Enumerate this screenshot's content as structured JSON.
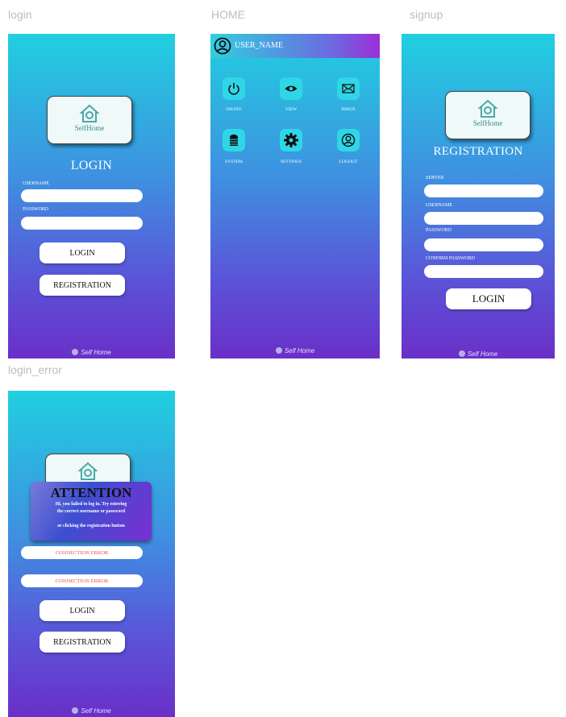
{
  "frames": {
    "login": "login",
    "home": "HOME",
    "signup": "signup",
    "login_error": "login_error"
  },
  "logo_text": "SelfHome",
  "footer_text": "Self Home",
  "login": {
    "title": "LOGIN",
    "username_label": "USERNAME",
    "password_label": "PASSWORD",
    "login_button": "LOGIN",
    "registration_button": "REGISTRATION"
  },
  "home": {
    "user_name": "USER_NAME",
    "tiles": [
      {
        "label": "ON/OFF",
        "icon": "power-icon"
      },
      {
        "label": "VIEW",
        "icon": "eye-icon"
      },
      {
        "label": "INBOX",
        "icon": "envelope-icon"
      },
      {
        "label": "SYSTEM",
        "icon": "stack-icon"
      },
      {
        "label": "SETTINGS",
        "icon": "gear-icon"
      },
      {
        "label": "LOGOUT",
        "icon": "user-circle-icon"
      }
    ]
  },
  "signup": {
    "title": "REGISTRATION",
    "server_label": "SERVER",
    "username_label": "USERNAME",
    "password_label": "PASSWORD",
    "confirm_label": "CONFIRM PASSWORD",
    "login_button": "LOGIN"
  },
  "login_error": {
    "attention_title": "ATTENTION",
    "message_line1": "Hi, you failed to log in. Try entering",
    "message_line2": "the correct username or password",
    "message_line3": "or clicking the registration button",
    "error1": "CONNECTION ERROR",
    "error2": "CONNECTION ERROR",
    "login_button": "LOGIN",
    "registration_button": "REGISTRATION"
  },
  "colors": {
    "gradient_top": "#21cfe0",
    "gradient_bottom": "#6a2fc8",
    "tile": "#2fd7e6",
    "error_text": "#e0524e"
  }
}
